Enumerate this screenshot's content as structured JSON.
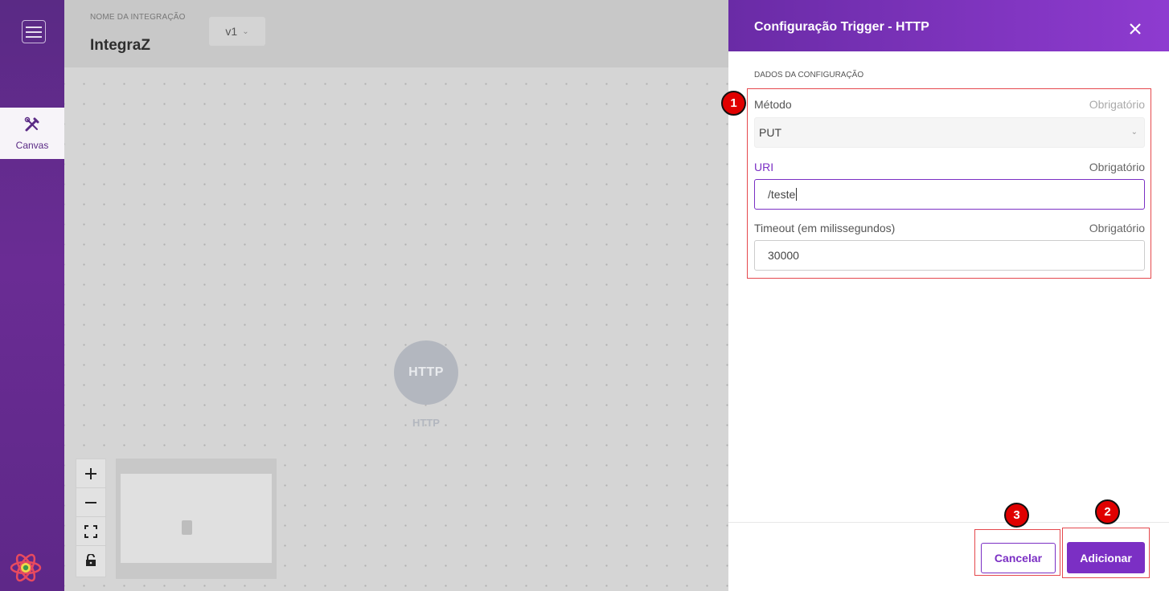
{
  "sidebar": {
    "canvas_tab_label": "Canvas"
  },
  "header": {
    "integration_label": "NOME DA INTEGRAÇÃO",
    "integration_name": "IntegraZ",
    "version": "v1"
  },
  "canvas": {
    "node_text": "HTTP",
    "node_label": "HTTP"
  },
  "panel": {
    "title": "Configuração Trigger - HTTP",
    "section_label": "DADOS DA CONFIGURAÇÃO",
    "fields": {
      "method": {
        "label": "Método",
        "required": "Obrigatório",
        "value": "PUT"
      },
      "uri": {
        "label": "URI",
        "required": "Obrigatório",
        "value": "/teste"
      },
      "timeout": {
        "label": "Timeout (em milissegundos)",
        "required": "Obrigatório",
        "value": "30000"
      }
    },
    "cancel_label": "Cancelar",
    "add_label": "Adicionar"
  },
  "annotations": {
    "marker_1": "1",
    "marker_2": "2",
    "marker_3": "3"
  },
  "colors": {
    "accent": "#7b2fc4",
    "sidebar": "#5a2a85",
    "highlight": "#e5484d",
    "marker": "#e00000"
  }
}
